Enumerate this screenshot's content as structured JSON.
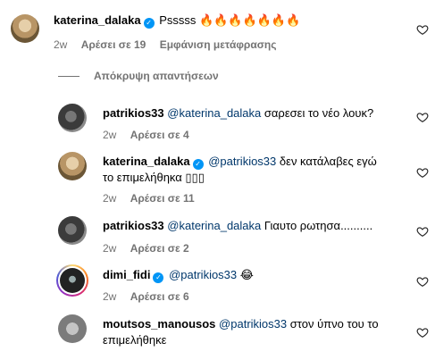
{
  "comments": [
    {
      "username": "katerina_dalaka",
      "verified": true,
      "mention": "",
      "text": "Psssss 🔥🔥🔥🔥🔥🔥🔥",
      "time": "2w",
      "likes": "Αρέσει σε 19",
      "translate": "Εμφάνιση μετάφρασης"
    },
    {
      "username": "patrikios33",
      "verified": false,
      "mention": "@katerina_dalaka",
      "text": "σαρεσει το νέο λουκ?",
      "time": "2w",
      "likes": "Αρέσει σε 4"
    },
    {
      "username": "katerina_dalaka",
      "verified": true,
      "mention": "@patrikios33",
      "text_line1": "δεν κατάλαβες εγώ",
      "text_line2": "το επιμελήθηκα ▯▯▯",
      "time": "2w",
      "likes": "Αρέσει σε 11"
    },
    {
      "username": "patrikios33",
      "verified": false,
      "mention": "@katerina_dalaka",
      "text": "Γιαυτο ρωτησα..........",
      "time": "2w",
      "likes": "Αρέσει σε 2"
    },
    {
      "username": "dimi_fidi",
      "verified": true,
      "mention": "@patrikios33",
      "text": "😂",
      "time": "2w",
      "likes": "Αρέσει σε 6"
    },
    {
      "username": "moutsos_manousos",
      "verified": false,
      "mention": "@patrikios33",
      "text_line1": "στον ύπνο του το",
      "text_line2": "επιμελήθηκε"
    }
  ],
  "hide_replies": "Απόκρυψη απαντήσεων",
  "icons": {
    "verified": "verified-badge-icon",
    "like": "heart-outline-icon"
  },
  "colors": {
    "verified": "#0095f6",
    "mention": "#00376b",
    "meta": "#737373"
  }
}
